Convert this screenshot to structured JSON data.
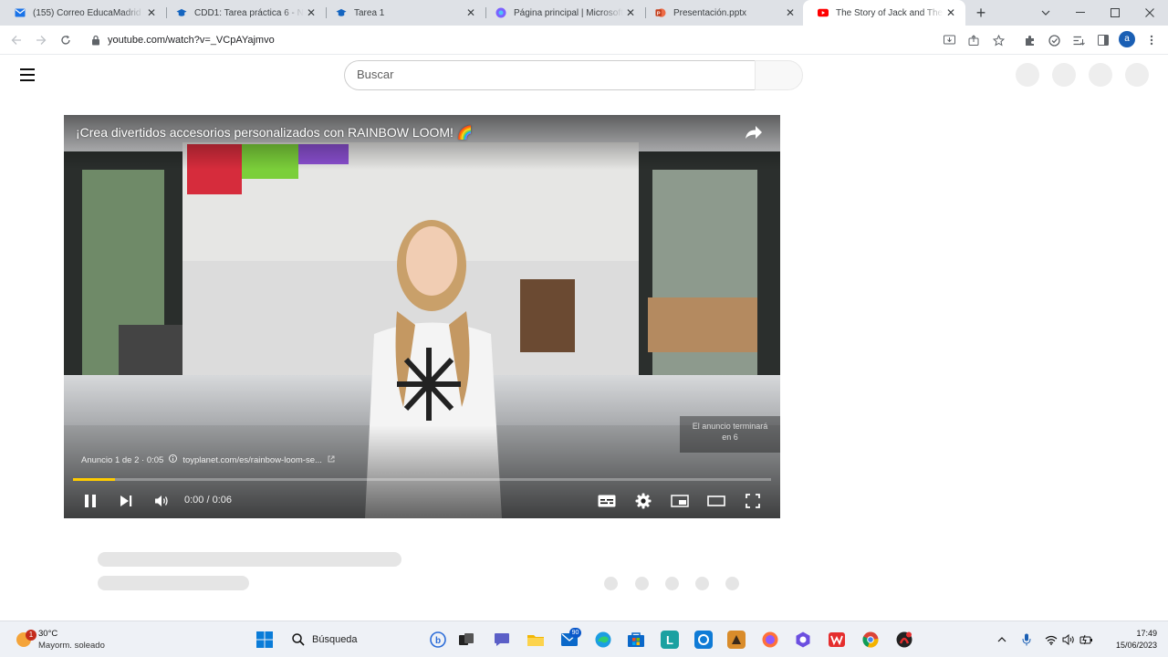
{
  "browser": {
    "tabs": [
      {
        "title": "(155) Correo EducaMadrid - Ni",
        "icon": "mail-icon",
        "color": "#1a73e8"
      },
      {
        "title": "CDD1: Tarea práctica 6 - Nive",
        "icon": "graduation-cap-icon",
        "color": "#1565c0"
      },
      {
        "title": "Tarea 1",
        "icon": "graduation-cap-icon",
        "color": "#1565c0"
      },
      {
        "title": "Página principal | Microsoft",
        "icon": "copilot-icon",
        "color": "#7b61ff"
      },
      {
        "title": "Presentación.pptx",
        "icon": "powerpoint-icon",
        "color": "#c43e1c"
      },
      {
        "title": "The Story of Jack and The",
        "icon": "youtube-icon",
        "color": "#ff0000"
      }
    ],
    "url": "youtube.com/watch?v=_VCpAYajmvo"
  },
  "youtube": {
    "search_placeholder": "Buscar"
  },
  "player": {
    "title": "¡Crea divertidos accesorios personalizados con RAINBOW LOOM! 🌈",
    "ad_counter": "Anuncio 1 de 2 · 0:05",
    "ad_link": "toyplanet.com/es/rainbow-loom-se...",
    "ad_end_line1": "El anuncio terminará",
    "ad_end_line2": "en 6",
    "time": "0:00 / 0:06",
    "progress": 0.06,
    "accent": "#ffcc00"
  },
  "taskbar": {
    "weather_notif": "1",
    "temperature": "30°C",
    "weather_desc": "Mayorm. soleado",
    "search_label": "Búsqueda",
    "mail_badge": "90",
    "time": "17:49",
    "date": "15/06/2023"
  }
}
